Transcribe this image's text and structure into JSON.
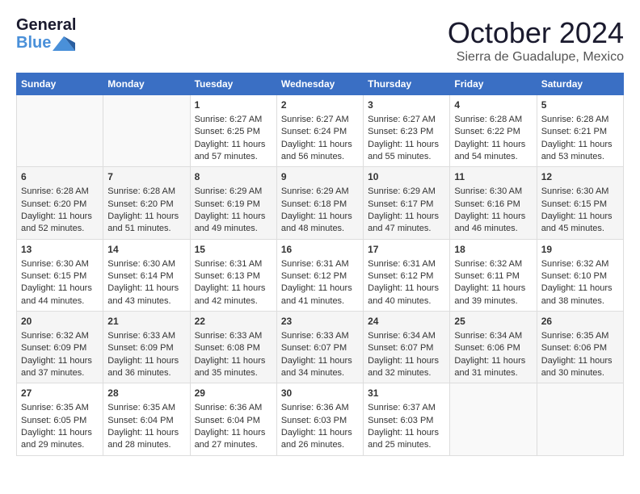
{
  "logo": {
    "line1": "General",
    "line2": "Blue"
  },
  "title": "October 2024",
  "location": "Sierra de Guadalupe, Mexico",
  "days_header": [
    "Sunday",
    "Monday",
    "Tuesday",
    "Wednesday",
    "Thursday",
    "Friday",
    "Saturday"
  ],
  "weeks": [
    [
      {
        "day": "",
        "sunrise": "",
        "sunset": "",
        "daylight": ""
      },
      {
        "day": "",
        "sunrise": "",
        "sunset": "",
        "daylight": ""
      },
      {
        "day": "1",
        "sunrise": "Sunrise: 6:27 AM",
        "sunset": "Sunset: 6:25 PM",
        "daylight": "Daylight: 11 hours and 57 minutes."
      },
      {
        "day": "2",
        "sunrise": "Sunrise: 6:27 AM",
        "sunset": "Sunset: 6:24 PM",
        "daylight": "Daylight: 11 hours and 56 minutes."
      },
      {
        "day": "3",
        "sunrise": "Sunrise: 6:27 AM",
        "sunset": "Sunset: 6:23 PM",
        "daylight": "Daylight: 11 hours and 55 minutes."
      },
      {
        "day": "4",
        "sunrise": "Sunrise: 6:28 AM",
        "sunset": "Sunset: 6:22 PM",
        "daylight": "Daylight: 11 hours and 54 minutes."
      },
      {
        "day": "5",
        "sunrise": "Sunrise: 6:28 AM",
        "sunset": "Sunset: 6:21 PM",
        "daylight": "Daylight: 11 hours and 53 minutes."
      }
    ],
    [
      {
        "day": "6",
        "sunrise": "Sunrise: 6:28 AM",
        "sunset": "Sunset: 6:20 PM",
        "daylight": "Daylight: 11 hours and 52 minutes."
      },
      {
        "day": "7",
        "sunrise": "Sunrise: 6:28 AM",
        "sunset": "Sunset: 6:20 PM",
        "daylight": "Daylight: 11 hours and 51 minutes."
      },
      {
        "day": "8",
        "sunrise": "Sunrise: 6:29 AM",
        "sunset": "Sunset: 6:19 PM",
        "daylight": "Daylight: 11 hours and 49 minutes."
      },
      {
        "day": "9",
        "sunrise": "Sunrise: 6:29 AM",
        "sunset": "Sunset: 6:18 PM",
        "daylight": "Daylight: 11 hours and 48 minutes."
      },
      {
        "day": "10",
        "sunrise": "Sunrise: 6:29 AM",
        "sunset": "Sunset: 6:17 PM",
        "daylight": "Daylight: 11 hours and 47 minutes."
      },
      {
        "day": "11",
        "sunrise": "Sunrise: 6:30 AM",
        "sunset": "Sunset: 6:16 PM",
        "daylight": "Daylight: 11 hours and 46 minutes."
      },
      {
        "day": "12",
        "sunrise": "Sunrise: 6:30 AM",
        "sunset": "Sunset: 6:15 PM",
        "daylight": "Daylight: 11 hours and 45 minutes."
      }
    ],
    [
      {
        "day": "13",
        "sunrise": "Sunrise: 6:30 AM",
        "sunset": "Sunset: 6:15 PM",
        "daylight": "Daylight: 11 hours and 44 minutes."
      },
      {
        "day": "14",
        "sunrise": "Sunrise: 6:30 AM",
        "sunset": "Sunset: 6:14 PM",
        "daylight": "Daylight: 11 hours and 43 minutes."
      },
      {
        "day": "15",
        "sunrise": "Sunrise: 6:31 AM",
        "sunset": "Sunset: 6:13 PM",
        "daylight": "Daylight: 11 hours and 42 minutes."
      },
      {
        "day": "16",
        "sunrise": "Sunrise: 6:31 AM",
        "sunset": "Sunset: 6:12 PM",
        "daylight": "Daylight: 11 hours and 41 minutes."
      },
      {
        "day": "17",
        "sunrise": "Sunrise: 6:31 AM",
        "sunset": "Sunset: 6:12 PM",
        "daylight": "Daylight: 11 hours and 40 minutes."
      },
      {
        "day": "18",
        "sunrise": "Sunrise: 6:32 AM",
        "sunset": "Sunset: 6:11 PM",
        "daylight": "Daylight: 11 hours and 39 minutes."
      },
      {
        "day": "19",
        "sunrise": "Sunrise: 6:32 AM",
        "sunset": "Sunset: 6:10 PM",
        "daylight": "Daylight: 11 hours and 38 minutes."
      }
    ],
    [
      {
        "day": "20",
        "sunrise": "Sunrise: 6:32 AM",
        "sunset": "Sunset: 6:09 PM",
        "daylight": "Daylight: 11 hours and 37 minutes."
      },
      {
        "day": "21",
        "sunrise": "Sunrise: 6:33 AM",
        "sunset": "Sunset: 6:09 PM",
        "daylight": "Daylight: 11 hours and 36 minutes."
      },
      {
        "day": "22",
        "sunrise": "Sunrise: 6:33 AM",
        "sunset": "Sunset: 6:08 PM",
        "daylight": "Daylight: 11 hours and 35 minutes."
      },
      {
        "day": "23",
        "sunrise": "Sunrise: 6:33 AM",
        "sunset": "Sunset: 6:07 PM",
        "daylight": "Daylight: 11 hours and 34 minutes."
      },
      {
        "day": "24",
        "sunrise": "Sunrise: 6:34 AM",
        "sunset": "Sunset: 6:07 PM",
        "daylight": "Daylight: 11 hours and 32 minutes."
      },
      {
        "day": "25",
        "sunrise": "Sunrise: 6:34 AM",
        "sunset": "Sunset: 6:06 PM",
        "daylight": "Daylight: 11 hours and 31 minutes."
      },
      {
        "day": "26",
        "sunrise": "Sunrise: 6:35 AM",
        "sunset": "Sunset: 6:06 PM",
        "daylight": "Daylight: 11 hours and 30 minutes."
      }
    ],
    [
      {
        "day": "27",
        "sunrise": "Sunrise: 6:35 AM",
        "sunset": "Sunset: 6:05 PM",
        "daylight": "Daylight: 11 hours and 29 minutes."
      },
      {
        "day": "28",
        "sunrise": "Sunrise: 6:35 AM",
        "sunset": "Sunset: 6:04 PM",
        "daylight": "Daylight: 11 hours and 28 minutes."
      },
      {
        "day": "29",
        "sunrise": "Sunrise: 6:36 AM",
        "sunset": "Sunset: 6:04 PM",
        "daylight": "Daylight: 11 hours and 27 minutes."
      },
      {
        "day": "30",
        "sunrise": "Sunrise: 6:36 AM",
        "sunset": "Sunset: 6:03 PM",
        "daylight": "Daylight: 11 hours and 26 minutes."
      },
      {
        "day": "31",
        "sunrise": "Sunrise: 6:37 AM",
        "sunset": "Sunset: 6:03 PM",
        "daylight": "Daylight: 11 hours and 25 minutes."
      },
      {
        "day": "",
        "sunrise": "",
        "sunset": "",
        "daylight": ""
      },
      {
        "day": "",
        "sunrise": "",
        "sunset": "",
        "daylight": ""
      }
    ]
  ]
}
